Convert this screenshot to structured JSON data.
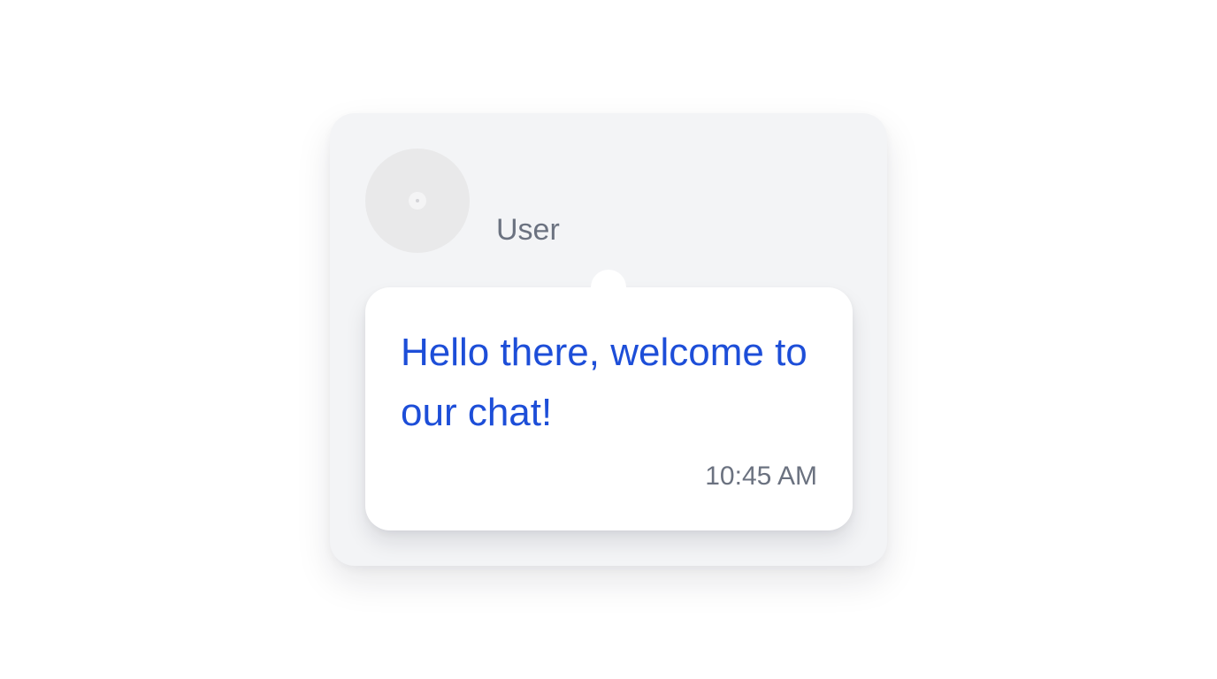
{
  "chat": {
    "user_name": "User",
    "avatar_icon": "user-avatar-icon",
    "message": {
      "text": "Hello there, welcome to our chat!",
      "time": "10:45 AM"
    }
  },
  "colors": {
    "message_text": "#1d4ed8",
    "secondary_text": "#6b7280",
    "card_background": "#f3f4f6",
    "bubble_background": "#ffffff"
  }
}
